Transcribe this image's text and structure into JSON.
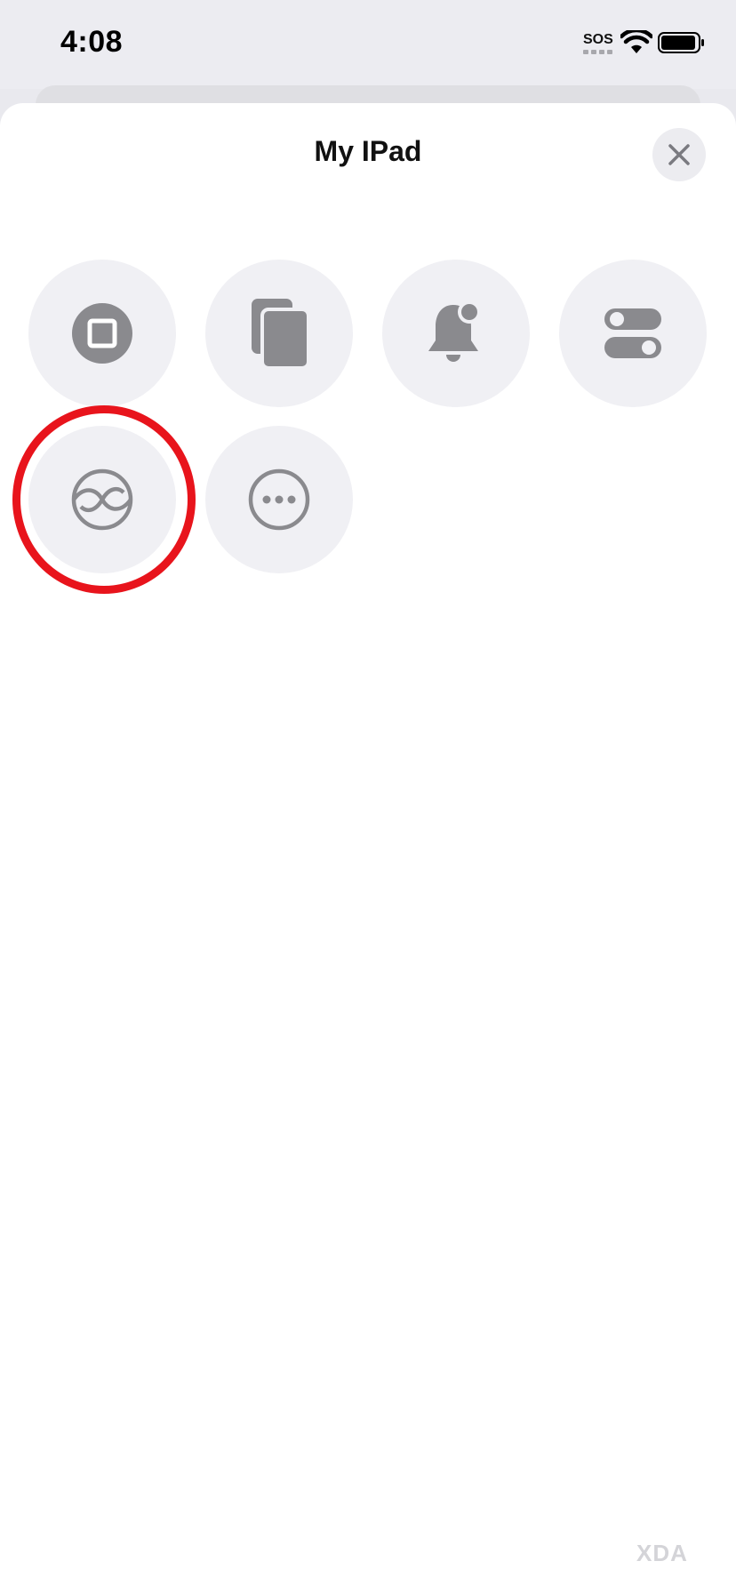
{
  "status_bar": {
    "time": "4:08",
    "sos": "SOS",
    "wifi_icon": "wifi-icon",
    "battery_icon": "battery-icon"
  },
  "sheet": {
    "title": "My IPad",
    "close_icon": "close-icon"
  },
  "actions": [
    {
      "icon": "stop-square-icon"
    },
    {
      "icon": "copy-icon"
    },
    {
      "icon": "bell-badge-icon"
    },
    {
      "icon": "toggles-icon"
    },
    {
      "icon": "infinity-universal-control-icon",
      "highlighted": true
    },
    {
      "icon": "more-ellipsis-icon"
    }
  ],
  "colors": {
    "icon_gray": "#8a8a8e",
    "highlight_red": "#e8141c",
    "button_bg": "#f0f0f4"
  },
  "watermark": "XDA"
}
